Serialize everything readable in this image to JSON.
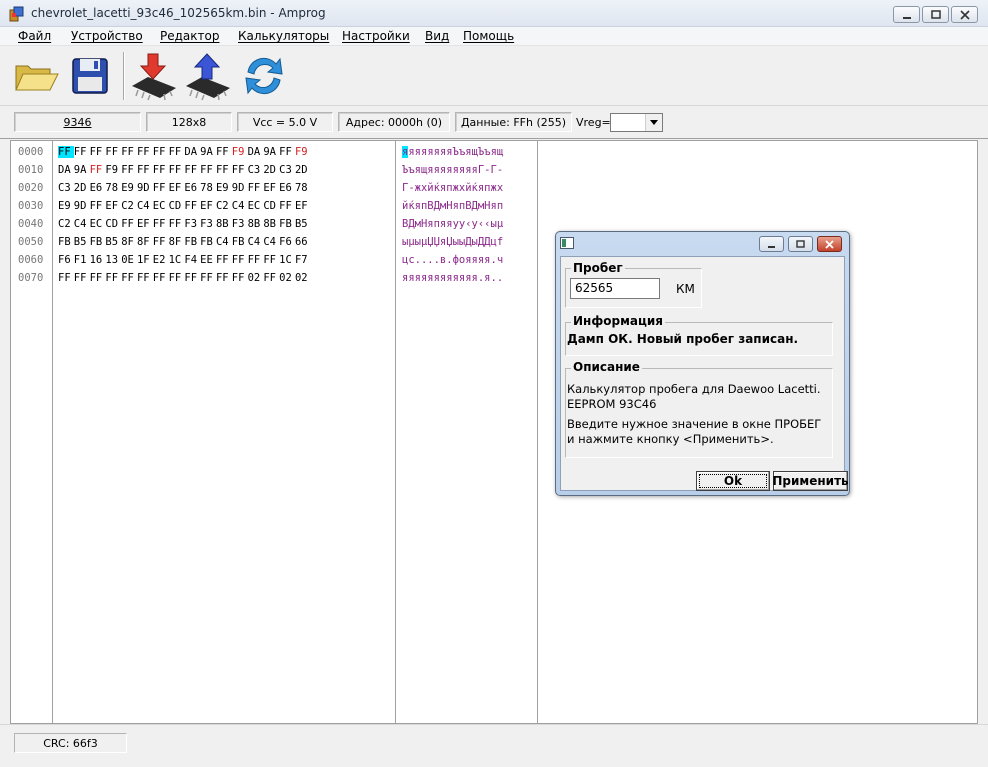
{
  "window": {
    "title": "chevrolet_lacetti_93c46_102565km.bin - Amprog"
  },
  "menu": [
    "Файл",
    "Устройство",
    "Редактор",
    "Калькуляторы",
    "Настройки",
    "Вид",
    "Помощь"
  ],
  "toolbar": {
    "buttons": [
      {
        "name": "open-folder-icon"
      },
      {
        "name": "save-floppy-icon"
      },
      {
        "name": "read-chip-icon"
      },
      {
        "name": "write-chip-icon"
      },
      {
        "name": "verify-refresh-icon"
      }
    ]
  },
  "infobar": {
    "chip": "9346",
    "organization": "128x8",
    "vcc": "Vcc = 5.0 V",
    "address": "Адрес: 0000h (0)",
    "data": "Данные: FFh (255)",
    "vreg_label": "Vreg=",
    "vreg_value": ""
  },
  "hex": {
    "rows": [
      {
        "addr": "0000",
        "bytes": [
          "FF",
          "FF",
          "FF",
          "FF",
          "FF",
          "FF",
          "FF",
          "FF",
          "DA",
          "9A",
          "FF",
          "F9",
          "DA",
          "9A",
          "FF",
          "F9"
        ],
        "ascii": "яяяяяяяяЪъящЪъящ"
      },
      {
        "addr": "0010",
        "bytes": [
          "DA",
          "9A",
          "FF",
          "F9",
          "FF",
          "FF",
          "FF",
          "FF",
          "FF",
          "FF",
          "FF",
          "FF",
          "C3",
          "2D",
          "C3",
          "2D"
        ],
        "ascii": "ЪъящяяяяяяяяГ-Г-"
      },
      {
        "addr": "0020",
        "bytes": [
          "C3",
          "2D",
          "E6",
          "78",
          "E9",
          "9D",
          "FF",
          "EF",
          "E6",
          "78",
          "E9",
          "9D",
          "FF",
          "EF",
          "E6",
          "78"
        ],
        "ascii": "Г-жхйќяпжхйќяпжх"
      },
      {
        "addr": "0030",
        "bytes": [
          "E9",
          "9D",
          "FF",
          "EF",
          "C2",
          "C4",
          "EC",
          "CD",
          "FF",
          "EF",
          "C2",
          "C4",
          "EC",
          "CD",
          "FF",
          "EF"
        ],
        "ascii": "йќяпВДмНяпВДмНяп"
      },
      {
        "addr": "0040",
        "bytes": [
          "C2",
          "C4",
          "EC",
          "CD",
          "FF",
          "EF",
          "FF",
          "FF",
          "F3",
          "F3",
          "8B",
          "F3",
          "8B",
          "8B",
          "FB",
          "B5"
        ],
        "ascii": "ВДмНяпяяуу‹у‹‹ыµ"
      },
      {
        "addr": "0050",
        "bytes": [
          "FB",
          "B5",
          "FB",
          "B5",
          "8F",
          "8F",
          "FF",
          "8F",
          "FB",
          "FB",
          "C4",
          "FB",
          "C4",
          "C4",
          "F6",
          "66"
        ],
        "ascii": "ыµыµЏЏяЏыыДыДДцf"
      },
      {
        "addr": "0060",
        "bytes": [
          "F6",
          "F1",
          "16",
          "13",
          "0E",
          "1F",
          "E2",
          "1C",
          "F4",
          "EE",
          "FF",
          "FF",
          "FF",
          "FF",
          "1C",
          "F7"
        ],
        "ascii": "цс....в.фояяяя.ч"
      },
      {
        "addr": "0070",
        "bytes": [
          "FF",
          "FF",
          "FF",
          "FF",
          "FF",
          "FF",
          "FF",
          "FF",
          "FF",
          "FF",
          "FF",
          "FF",
          "02",
          "FF",
          "02",
          "02"
        ],
        "ascii": "яяяяяяяяяяяя.я.."
      }
    ],
    "red_positions": [
      [
        0,
        11
      ],
      [
        0,
        15
      ],
      [
        1,
        2
      ]
    ],
    "selected": [
      0,
      0
    ]
  },
  "dialog": {
    "mileage_group": "Пробег",
    "mileage_value": "62565",
    "mileage_unit": "КМ",
    "info_group": "Информация",
    "info_text": "Дамп ОК. Новый пробег записан.",
    "desc_group": "Описание",
    "desc_line1": "Калькулятор пробега для Daewoo Lacetti.",
    "desc_line2": "EEPROM 93C46",
    "desc_line3": "Введите нужное значение в окне ПРОБЕГ",
    "desc_line4": "и нажмите кнопку <Применить>.",
    "ok_label": "Ok",
    "apply_label": "Применить"
  },
  "status": {
    "crc": "CRC: 66f3"
  }
}
